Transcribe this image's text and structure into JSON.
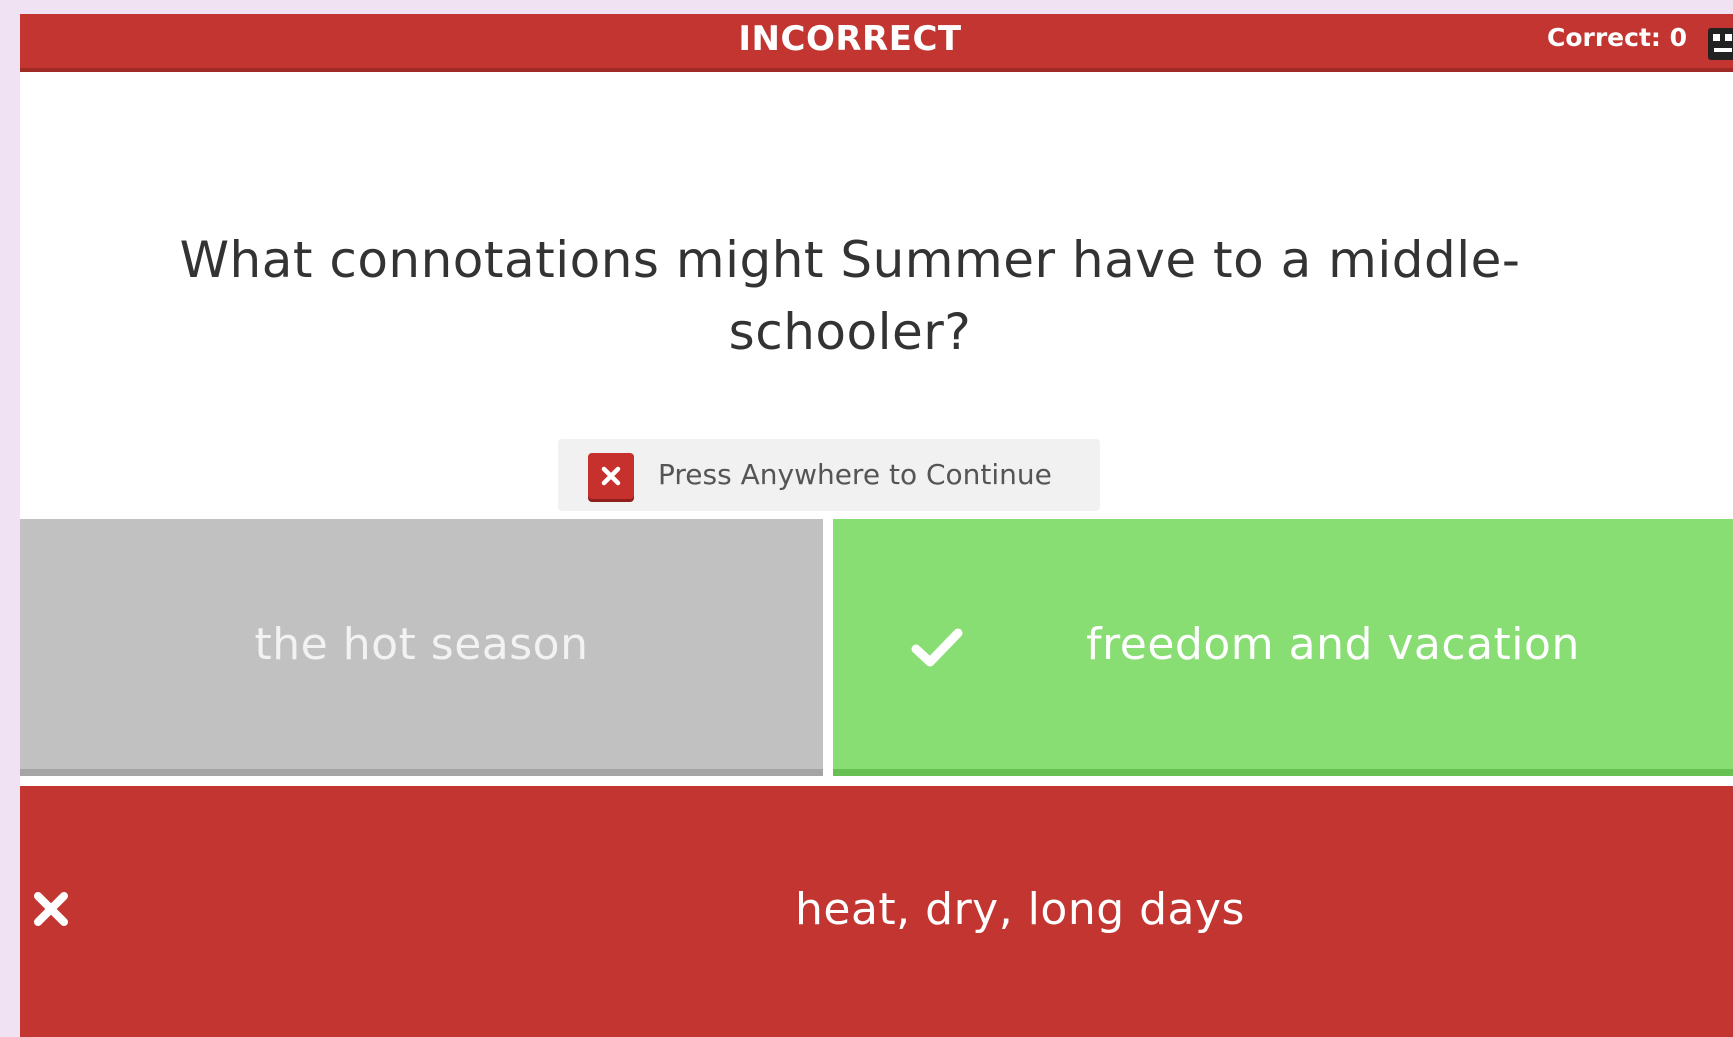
{
  "header": {
    "status": "INCORRECT",
    "score_label": "Correct: 0",
    "avatar_icon": "player-avatar-icon"
  },
  "question": {
    "text": "What connotations might Summer have to a middle-schooler?"
  },
  "feedback": {
    "continue_label": "Press Anywhere to Continue",
    "icon": "close-icon"
  },
  "answers": [
    {
      "label": "the hot season",
      "state": "neutral",
      "color": "#c1c1c1"
    },
    {
      "label": "freedom and vacation",
      "state": "correct",
      "icon": "check-icon",
      "color": "#88dd73"
    },
    {
      "label": "heat, dry, long days",
      "state": "selected-incorrect",
      "icon": "close-icon",
      "color": "#c23531"
    }
  ],
  "colors": {
    "incorrect": "#c23531",
    "correct": "#88dd73",
    "neutral": "#c1c1c1",
    "background": "#f0e1f3"
  }
}
